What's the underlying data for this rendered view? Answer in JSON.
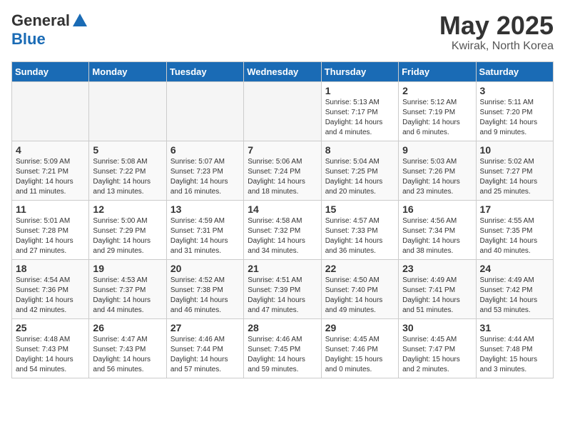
{
  "header": {
    "logo_general": "General",
    "logo_blue": "Blue",
    "month": "May 2025",
    "location": "Kwirak, North Korea"
  },
  "weekdays": [
    "Sunday",
    "Monday",
    "Tuesday",
    "Wednesday",
    "Thursday",
    "Friday",
    "Saturday"
  ],
  "weeks": [
    [
      {
        "day": "",
        "info": ""
      },
      {
        "day": "",
        "info": ""
      },
      {
        "day": "",
        "info": ""
      },
      {
        "day": "",
        "info": ""
      },
      {
        "day": "1",
        "info": "Sunrise: 5:13 AM\nSunset: 7:17 PM\nDaylight: 14 hours\nand 4 minutes."
      },
      {
        "day": "2",
        "info": "Sunrise: 5:12 AM\nSunset: 7:19 PM\nDaylight: 14 hours\nand 6 minutes."
      },
      {
        "day": "3",
        "info": "Sunrise: 5:11 AM\nSunset: 7:20 PM\nDaylight: 14 hours\nand 9 minutes."
      }
    ],
    [
      {
        "day": "4",
        "info": "Sunrise: 5:09 AM\nSunset: 7:21 PM\nDaylight: 14 hours\nand 11 minutes."
      },
      {
        "day": "5",
        "info": "Sunrise: 5:08 AM\nSunset: 7:22 PM\nDaylight: 14 hours\nand 13 minutes."
      },
      {
        "day": "6",
        "info": "Sunrise: 5:07 AM\nSunset: 7:23 PM\nDaylight: 14 hours\nand 16 minutes."
      },
      {
        "day": "7",
        "info": "Sunrise: 5:06 AM\nSunset: 7:24 PM\nDaylight: 14 hours\nand 18 minutes."
      },
      {
        "day": "8",
        "info": "Sunrise: 5:04 AM\nSunset: 7:25 PM\nDaylight: 14 hours\nand 20 minutes."
      },
      {
        "day": "9",
        "info": "Sunrise: 5:03 AM\nSunset: 7:26 PM\nDaylight: 14 hours\nand 23 minutes."
      },
      {
        "day": "10",
        "info": "Sunrise: 5:02 AM\nSunset: 7:27 PM\nDaylight: 14 hours\nand 25 minutes."
      }
    ],
    [
      {
        "day": "11",
        "info": "Sunrise: 5:01 AM\nSunset: 7:28 PM\nDaylight: 14 hours\nand 27 minutes."
      },
      {
        "day": "12",
        "info": "Sunrise: 5:00 AM\nSunset: 7:29 PM\nDaylight: 14 hours\nand 29 minutes."
      },
      {
        "day": "13",
        "info": "Sunrise: 4:59 AM\nSunset: 7:31 PM\nDaylight: 14 hours\nand 31 minutes."
      },
      {
        "day": "14",
        "info": "Sunrise: 4:58 AM\nSunset: 7:32 PM\nDaylight: 14 hours\nand 34 minutes."
      },
      {
        "day": "15",
        "info": "Sunrise: 4:57 AM\nSunset: 7:33 PM\nDaylight: 14 hours\nand 36 minutes."
      },
      {
        "day": "16",
        "info": "Sunrise: 4:56 AM\nSunset: 7:34 PM\nDaylight: 14 hours\nand 38 minutes."
      },
      {
        "day": "17",
        "info": "Sunrise: 4:55 AM\nSunset: 7:35 PM\nDaylight: 14 hours\nand 40 minutes."
      }
    ],
    [
      {
        "day": "18",
        "info": "Sunrise: 4:54 AM\nSunset: 7:36 PM\nDaylight: 14 hours\nand 42 minutes."
      },
      {
        "day": "19",
        "info": "Sunrise: 4:53 AM\nSunset: 7:37 PM\nDaylight: 14 hours\nand 44 minutes."
      },
      {
        "day": "20",
        "info": "Sunrise: 4:52 AM\nSunset: 7:38 PM\nDaylight: 14 hours\nand 46 minutes."
      },
      {
        "day": "21",
        "info": "Sunrise: 4:51 AM\nSunset: 7:39 PM\nDaylight: 14 hours\nand 47 minutes."
      },
      {
        "day": "22",
        "info": "Sunrise: 4:50 AM\nSunset: 7:40 PM\nDaylight: 14 hours\nand 49 minutes."
      },
      {
        "day": "23",
        "info": "Sunrise: 4:49 AM\nSunset: 7:41 PM\nDaylight: 14 hours\nand 51 minutes."
      },
      {
        "day": "24",
        "info": "Sunrise: 4:49 AM\nSunset: 7:42 PM\nDaylight: 14 hours\nand 53 minutes."
      }
    ],
    [
      {
        "day": "25",
        "info": "Sunrise: 4:48 AM\nSunset: 7:43 PM\nDaylight: 14 hours\nand 54 minutes."
      },
      {
        "day": "26",
        "info": "Sunrise: 4:47 AM\nSunset: 7:43 PM\nDaylight: 14 hours\nand 56 minutes."
      },
      {
        "day": "27",
        "info": "Sunrise: 4:46 AM\nSunset: 7:44 PM\nDaylight: 14 hours\nand 57 minutes."
      },
      {
        "day": "28",
        "info": "Sunrise: 4:46 AM\nSunset: 7:45 PM\nDaylight: 14 hours\nand 59 minutes."
      },
      {
        "day": "29",
        "info": "Sunrise: 4:45 AM\nSunset: 7:46 PM\nDaylight: 15 hours\nand 0 minutes."
      },
      {
        "day": "30",
        "info": "Sunrise: 4:45 AM\nSunset: 7:47 PM\nDaylight: 15 hours\nand 2 minutes."
      },
      {
        "day": "31",
        "info": "Sunrise: 4:44 AM\nSunset: 7:48 PM\nDaylight: 15 hours\nand 3 minutes."
      }
    ]
  ]
}
